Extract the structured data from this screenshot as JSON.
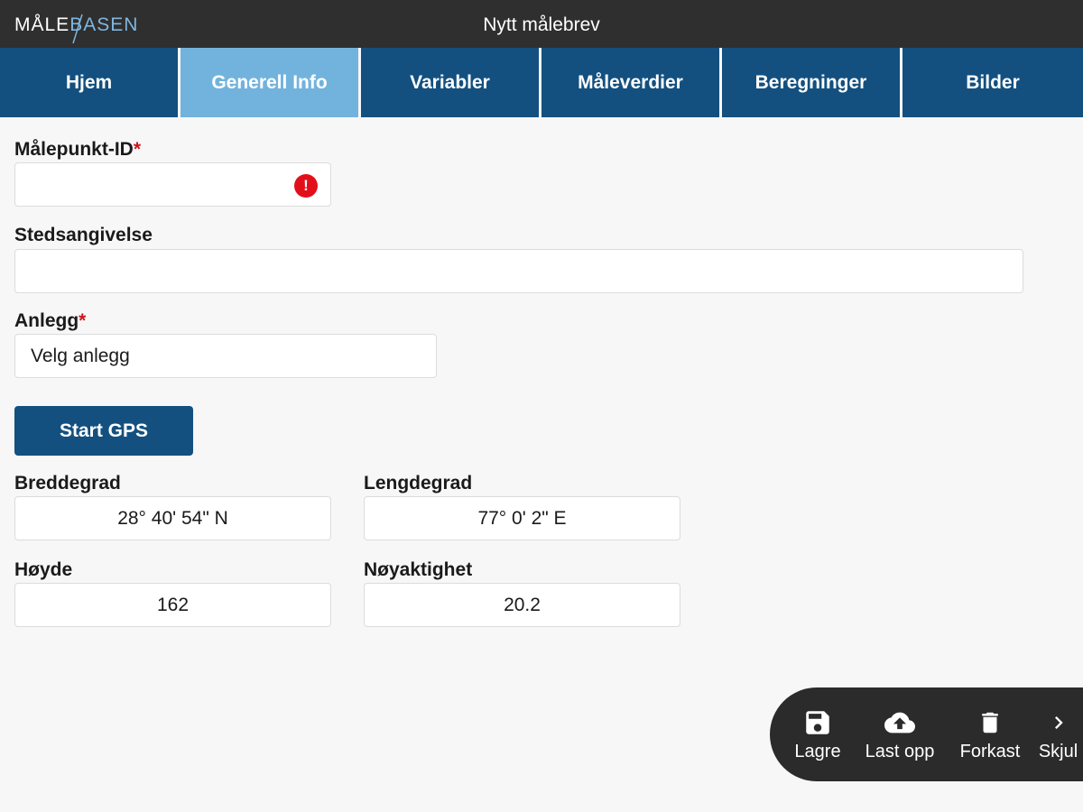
{
  "header": {
    "logo_part1": "MÅLE",
    "logo_part2": "BASEN",
    "title": "Nytt målebrev"
  },
  "tabs": [
    {
      "label": "Hjem",
      "active": false
    },
    {
      "label": "Generell Info",
      "active": true
    },
    {
      "label": "Variabler",
      "active": false
    },
    {
      "label": "Måleverdier",
      "active": false
    },
    {
      "label": "Beregninger",
      "active": false
    },
    {
      "label": "Bilder",
      "active": false
    }
  ],
  "form": {
    "malepunkt_label": "Målepunkt-ID",
    "malepunkt_value": "",
    "required_mark": "*",
    "error_mark": "!",
    "stedsangivelse_label": "Stedsangivelse",
    "stedsangivelse_value": "",
    "anlegg_label": "Anlegg",
    "anlegg_value": "Velg anlegg",
    "gps_button": "Start GPS",
    "breddegrad_label": "Breddegrad",
    "breddegrad_value": "28° 40' 54\" N",
    "lengdegrad_label": "Lengdegrad",
    "lengdegrad_value": "77° 0' 2\" E",
    "hoyde_label": "Høyde",
    "hoyde_value": "162",
    "noyaktighet_label": "Nøyaktighet",
    "noyaktighet_value": "20.2"
  },
  "actions": {
    "save": "Lagre",
    "upload": "Last opp",
    "discard": "Forkast",
    "hide": "Skjul"
  },
  "colors": {
    "topbar": "#2f2f2f",
    "tab": "#13507f",
    "tab_active": "#72b3dd",
    "required": "#d0121a",
    "error": "#e20f1b"
  }
}
